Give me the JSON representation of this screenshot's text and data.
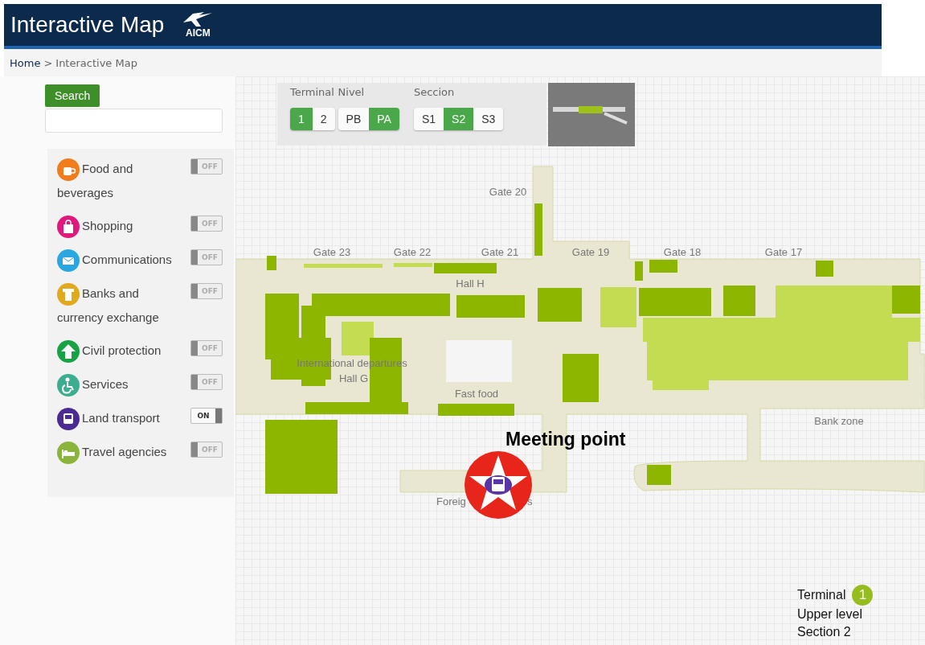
{
  "header": {
    "title": "Interactive Map",
    "logo_text": "AICM"
  },
  "breadcrumb": {
    "home": "Home",
    "separator": ">",
    "current": "Interactive Map"
  },
  "search": {
    "button": "Search"
  },
  "categories": [
    {
      "kind": "food",
      "label": "Food and beverages",
      "color": "#f07c1c",
      "on": false,
      "toggle_text": "OFF"
    },
    {
      "kind": "shopping",
      "label": "Shopping",
      "color": "#e0197d",
      "on": false,
      "toggle_text": "OFF"
    },
    {
      "kind": "communications",
      "label": "Communications",
      "color": "#2aa7e0",
      "on": false,
      "toggle_text": "OFF"
    },
    {
      "kind": "banks",
      "label": "Banks and currency exchange",
      "color": "#e0a91e",
      "on": false,
      "toggle_text": "OFF"
    },
    {
      "kind": "civil",
      "label": "Civil protection",
      "color": "#17a345",
      "on": false,
      "toggle_text": "OFF"
    },
    {
      "kind": "services",
      "label": "Services",
      "color": "#3cae8f",
      "on": false,
      "toggle_text": "OFF"
    },
    {
      "kind": "transport",
      "label": "Land transport",
      "color": "#4b2a93",
      "on": true,
      "toggle_text": "ON"
    },
    {
      "kind": "travel",
      "label": "Travel agencies",
      "color": "#8bb43a",
      "on": false,
      "toggle_text": "OFF"
    }
  ],
  "selectors": [
    {
      "label": "Terminal",
      "options": [
        {
          "label": "1",
          "selected": true
        },
        {
          "label": "2",
          "selected": false
        }
      ]
    },
    {
      "label": "Nivel",
      "options": [
        {
          "label": "PB",
          "selected": false
        },
        {
          "label": "PA",
          "selected": true
        }
      ]
    },
    {
      "label": "Seccion",
      "options": [
        {
          "label": "S1",
          "selected": false
        },
        {
          "label": "S2",
          "selected": true
        },
        {
          "label": "S3",
          "selected": false
        }
      ]
    }
  ],
  "map": {
    "labels": [
      "Gate 20",
      "Gate 23",
      "Gate 22",
      "Gate 21",
      "Gate 19",
      "Gate 18",
      "Gate 17",
      "Hall H",
      "International  departures",
      "Hall G",
      "Fast food",
      "Bank zone",
      "Foreig",
      "s"
    ],
    "marker": {
      "label": "Meeting point"
    }
  },
  "legend": {
    "terminal_label": "Terminal",
    "terminal_number": "1",
    "level": "Upper level",
    "section": "Section 2"
  }
}
